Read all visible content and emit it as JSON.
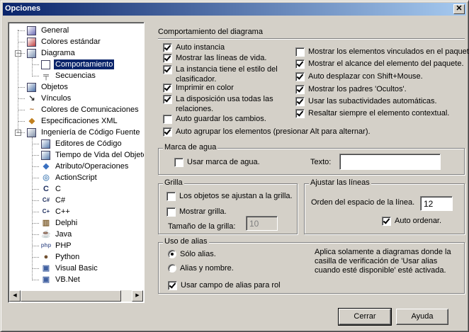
{
  "window": {
    "title": "Opciones",
    "close_label": "✕"
  },
  "tree": {
    "items": [
      {
        "label": "General",
        "icon": "general-icon"
      },
      {
        "label": "Colores estándar",
        "icon": "colors-icon"
      },
      {
        "label": "Diagrama",
        "icon": "diagram-icon",
        "expanded": true
      },
      {
        "label": "Comportamiento",
        "icon": "behavior-icon",
        "selected": true
      },
      {
        "label": "Secuencias",
        "icon": "sequence-icon"
      },
      {
        "label": "Objetos",
        "icon": "objects-icon"
      },
      {
        "label": "Vínculos",
        "icon": "links-icon"
      },
      {
        "label": "Colores de Comunicaciones",
        "icon": "communication-colors-icon"
      },
      {
        "label": "Especificaciones XML",
        "icon": "xml-icon"
      },
      {
        "label": "Ingeniería de Código Fuente",
        "icon": "source-engineering-icon",
        "expanded": true
      },
      {
        "label": "Editores de Código",
        "icon": "code-editor-icon"
      },
      {
        "label": "Tiempo de Vida del Objeto",
        "icon": "object-lifetime-icon"
      },
      {
        "label": "Atributo/Operaciones",
        "icon": "attribute-icon"
      },
      {
        "label": "ActionScript",
        "icon": "actionscript-icon"
      },
      {
        "label": "C",
        "icon": "c-icon"
      },
      {
        "label": "C#",
        "icon": "csharp-icon"
      },
      {
        "label": "C++",
        "icon": "cpp-icon"
      },
      {
        "label": "Delphi",
        "icon": "delphi-icon"
      },
      {
        "label": "Java",
        "icon": "java-icon"
      },
      {
        "label": "PHP",
        "icon": "php-icon"
      },
      {
        "label": "Python",
        "icon": "python-icon"
      },
      {
        "label": "Visual Basic",
        "icon": "visual-basic-icon"
      },
      {
        "label": "VB.Net",
        "icon": "vbnet-icon"
      }
    ]
  },
  "behavior": {
    "heading": "Comportamiento del diagrama",
    "left_options": [
      {
        "label": "Auto instancia",
        "checked": true
      },
      {
        "label": "Mostrar las líneas de vida.",
        "checked": true
      },
      {
        "label": "La instancia tiene el estilo del",
        "label2": "clasificador.",
        "checked": true
      },
      {
        "label": "Imprimir en color",
        "checked": true
      },
      {
        "label": "La disposición usa todas las",
        "label2": "relaciones.",
        "checked": true
      },
      {
        "label": "Auto guardar los cambios.",
        "checked": false
      },
      {
        "label": "Auto agrupar los elementos (presionar Alt para alternar).",
        "checked": true
      }
    ],
    "right_options": [
      {
        "label": "Mostrar los elementos vinculados en el paquete.",
        "checked": false
      },
      {
        "label": "Mostrar el alcance del elemento del paquete.",
        "checked": true
      },
      {
        "label": "Auto desplazar con Shift+Mouse.",
        "checked": true
      },
      {
        "label": "Mostrar los padres 'Ocultos'.",
        "checked": true
      },
      {
        "label": "Usar las subactividades automáticas.",
        "checked": true
      },
      {
        "label": "Resaltar siempre el elemento contextual.",
        "checked": true
      }
    ]
  },
  "watermark": {
    "legend": "Marca de agua",
    "use_label": "Usar marca de agua.",
    "use_checked": false,
    "text_label": "Texto:",
    "text_value": ""
  },
  "grid": {
    "legend": "Grilla",
    "snap_label": "Los objetos se ajustan a la grilla.",
    "snap_checked": false,
    "show_label": "Mostrar grilla.",
    "show_checked": false,
    "size_label": "Tamaño de la grilla:",
    "size_value": "10"
  },
  "lines": {
    "legend": "Ajustar las líneas",
    "order_label": "Orden del espacio de la línea.",
    "order_value": "12",
    "auto_label": "Auto ordenar.",
    "auto_checked": true
  },
  "alias": {
    "legend": "Uso de alias",
    "only_alias": "Sólo alias.",
    "alias_and_name": "Alias y nombre.",
    "selected": "only_alias",
    "use_field_label": "Usar campo de alias para rol",
    "use_field_checked": true,
    "note": "Aplica solamente a diagramas donde la casilla de verificación de 'Usar alias cuando esté disponible' esté activada."
  },
  "buttons": {
    "close": "Cerrar",
    "help": "Ayuda"
  }
}
